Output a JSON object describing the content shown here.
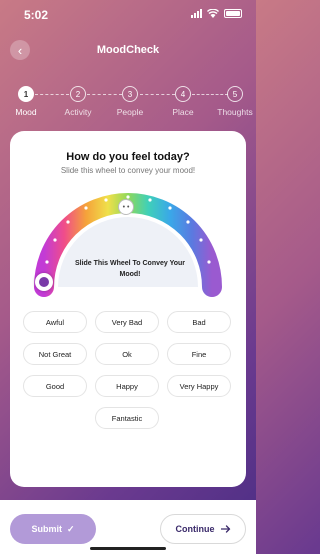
{
  "status": {
    "time": "5:02"
  },
  "header": {
    "title": "MoodCheck",
    "back_icon": "chevron-left-icon"
  },
  "steps": [
    {
      "num": "1",
      "label": "Mood",
      "active": true
    },
    {
      "num": "2",
      "label": "Activity",
      "active": false
    },
    {
      "num": "3",
      "label": "People",
      "active": false
    },
    {
      "num": "4",
      "label": "Place",
      "active": false
    },
    {
      "num": "5",
      "label": "Thoughts",
      "active": false
    }
  ],
  "card": {
    "title": "How do you feel today?",
    "subtitle": "Slide this wheel to convey your mood!",
    "wheel_label": "Slide This Wheel To Convey Your Mood!"
  },
  "moods": [
    "Awful",
    "Very Bad",
    "Bad",
    "Not Great",
    "Ok",
    "Fine",
    "Good",
    "Happy",
    "Very Happy",
    "Fantastic"
  ],
  "footer": {
    "submit_label": "Submit",
    "continue_label": "Continue"
  },
  "colors": {
    "accent": "#7a3aa8",
    "submit_bg": "#b29ad8"
  }
}
